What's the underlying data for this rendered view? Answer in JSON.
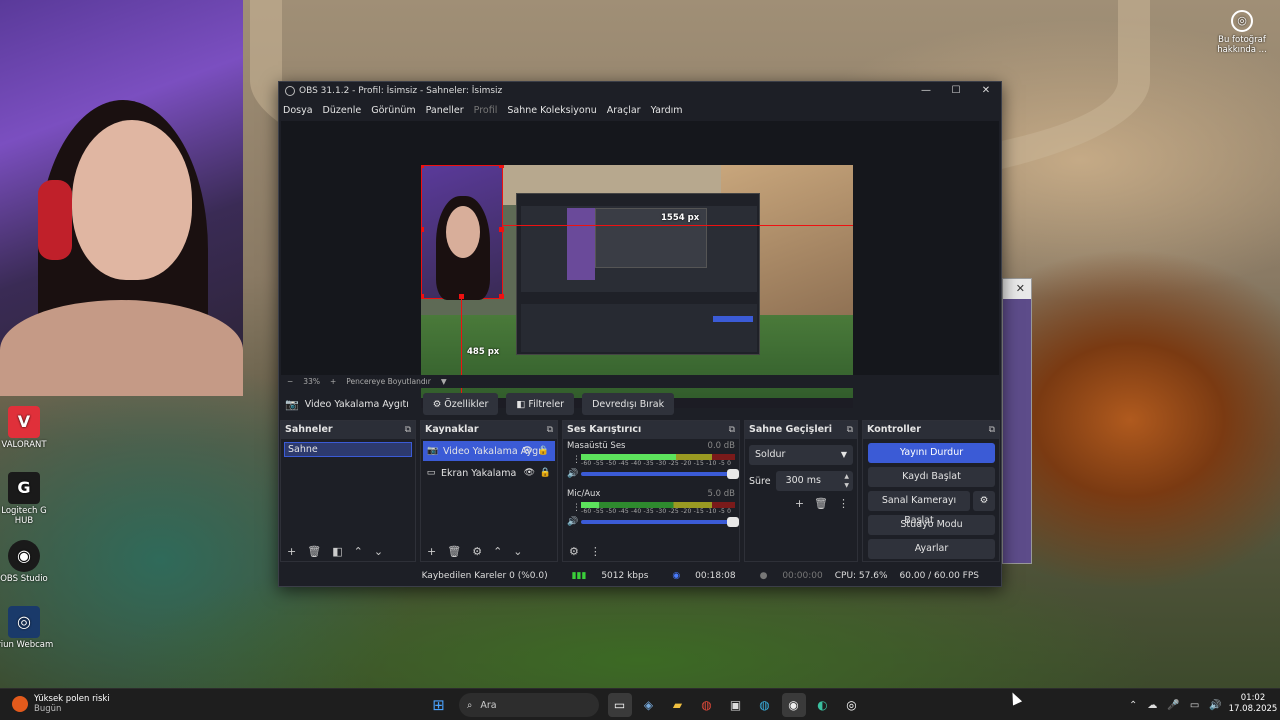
{
  "desktop": {
    "photo_info_label": "Bu fotoğraf hakkında ...",
    "icons": [
      {
        "label": "VALORANT",
        "icon": "valorant-icon",
        "color": "#e0303a"
      },
      {
        "label": "Logitech G HUB",
        "icon": "logitech-g-icon",
        "color": "#1a1a1a"
      },
      {
        "label": "OBS Studio",
        "icon": "obs-icon",
        "color": "#1a1a1a"
      },
      {
        "label": "Iriun Webcam",
        "icon": "iriun-icon",
        "color": "#1a3a6a"
      }
    ],
    "bg_window_close": "✕"
  },
  "obs": {
    "title": "OBS 31.1.2 - Profil: İsimsiz - Sahneler: İsimsiz",
    "window_buttons": {
      "minimize": "—",
      "maximize": "☐",
      "close": "✕"
    },
    "menu": [
      "Dosya",
      "Düzenle",
      "Görünüm",
      "Paneller",
      "Profil",
      "Sahne Koleksiyonu",
      "Araçlar",
      "Yardım"
    ],
    "preview": {
      "measure_h": "1554 px",
      "measure_v": "485 px"
    },
    "zoom": {
      "minus": "−",
      "value": "33%",
      "plus": "+",
      "fit": "Pencereye Boyutlandır",
      "arrow": "▼"
    },
    "source_toolbar": {
      "source_name": "Video Yakalama Aygıtı",
      "properties": "Özellikler",
      "filters": "Filtreler",
      "deactivate": "Devredışı Bırak"
    },
    "scenes": {
      "title": "Sahneler",
      "items": [
        "Sahne"
      ]
    },
    "sources": {
      "title": "Kaynaklar",
      "items": [
        {
          "name": "Video Yakalama Aygıtı",
          "selected": true
        },
        {
          "name": "Ekran Yakalama",
          "selected": false
        }
      ]
    },
    "mixer": {
      "title": "Ses Karıştırıcı",
      "ticks": "-60 -55 -50 -45 -40 -35 -30 -25 -20 -15 -10 -5 0",
      "channels": [
        {
          "name": "Masaüstü Ses",
          "db": "0.0 dB",
          "level": 0.62
        },
        {
          "name": "Mic/Aux",
          "db": "5.0 dB",
          "level": 0.12
        }
      ]
    },
    "transitions": {
      "title": "Sahne Geçişleri",
      "type": "Soldur",
      "duration_label": "Süre",
      "duration": "300 ms"
    },
    "controls": {
      "title": "Kontroller",
      "buttons": [
        "Yayını Durdur",
        "Kaydı Başlat",
        "Sanal Kamerayı Başlat",
        "Stüdyo Modu",
        "Ayarlar"
      ]
    },
    "status": {
      "dropped": "Kaybedilen Kareler 0 (%0.0)",
      "bitrate": "5012 kbps",
      "stream_time": "00:18:08",
      "rec_time": "00:00:00",
      "cpu": "CPU: 57.6%",
      "fps": "60.00 / 60.00 FPS"
    }
  },
  "taskbar": {
    "weather_title": "Yüksek polen riski",
    "weather_sub": "Bugün",
    "search_placeholder": "Ara",
    "clock_time": "01:02",
    "clock_date": "17.08.2025"
  },
  "colors": {
    "accent": "#3b5bd6",
    "selection_red": "#ee1111",
    "dock_bg": "#1d1f26"
  }
}
